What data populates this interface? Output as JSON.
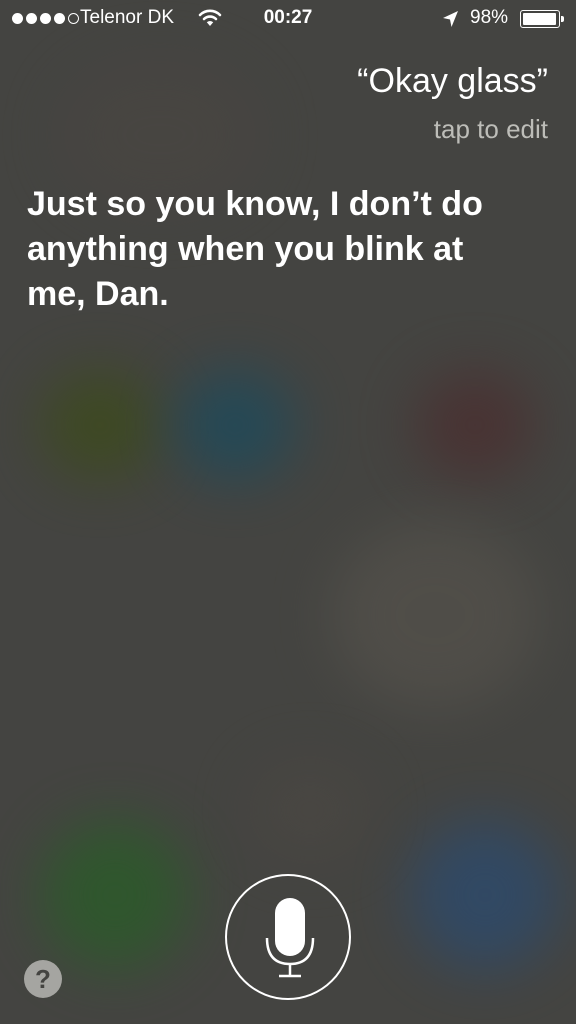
{
  "status_bar": {
    "signal_bars_filled": 4,
    "signal_bars_total": 5,
    "carrier": "Telenor DK",
    "time": "00:27",
    "battery_percent": "98%",
    "battery_level": 0.98,
    "icons": [
      "wifi-icon",
      "location-arrow-icon",
      "battery-icon"
    ]
  },
  "siri": {
    "query": "“Okay glass”",
    "tap_to_edit": "tap to edit",
    "response": "Just so you know, I don’t do anything when you blink at me, Dan."
  },
  "controls": {
    "mic_icon": "microphone-icon",
    "help_label": "?"
  },
  "colors": {
    "background": "#444441",
    "text": "#ffffff",
    "secondary_text": "#bdbdb8"
  }
}
